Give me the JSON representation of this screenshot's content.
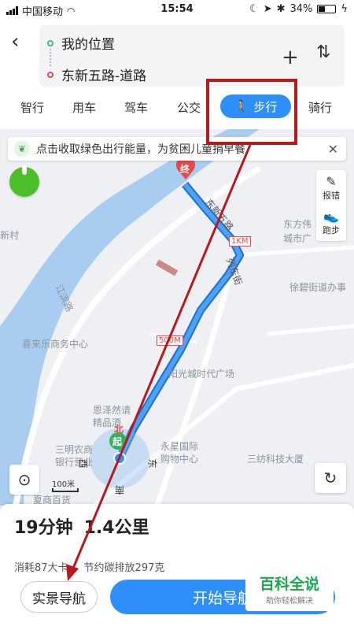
{
  "status_bar": {
    "carrier": "中国移动",
    "time": "15:54",
    "battery": "34%"
  },
  "route": {
    "origin": "我的位置",
    "destination": "东新五路-道路"
  },
  "tabs": [
    {
      "label": "智行"
    },
    {
      "label": "用车"
    },
    {
      "label": "驾车"
    },
    {
      "label": "公交"
    },
    {
      "label": "步行",
      "active": true
    },
    {
      "label": "骑行"
    }
  ],
  "banner": {
    "text": "点击收取绿色出行能量，为贫困儿童捐早餐"
  },
  "side_tools": {
    "report": "报错",
    "run": "跑步"
  },
  "map_labels": {
    "end_marker": "终",
    "start_marker": "起",
    "north": "北",
    "distance_1km": "1KM",
    "distance_500m": "500M",
    "street1": "东新五路",
    "street2": "列东街",
    "place1": "东方伟",
    "place1b": "城市广",
    "place2": "徐碧街道办事",
    "place3": "喜来乐商务中心",
    "place4": "阳光城时代广场",
    "place5": "恩泽然请",
    "place5b": "精品酒",
    "place6": "永星国际",
    "place6b": "购物中心",
    "place7": "三纺科技大厦",
    "place8": "三明农商",
    "place8b": "银行营业",
    "place9": "夏商百货",
    "river": "江滨路",
    "left_edge": "新村",
    "dir_west": "西",
    "dir_east": "东",
    "dir_south": "南",
    "scale": "100米"
  },
  "summary": {
    "time": "19分钟",
    "distance": "1.4公里",
    "calories": "消耗87大卡",
    "carbon": "节约碳排放297克"
  },
  "buttons": {
    "ar_nav": "实景导航",
    "start_nav": "开始导航"
  },
  "watermark": {
    "title": "百科全说",
    "subtitle": "助你轻松解决"
  },
  "colors": {
    "accent": "#2f8ffa",
    "route": "#3a8ef0",
    "highlight": "#b8191c",
    "green": "#4dbe2a"
  }
}
